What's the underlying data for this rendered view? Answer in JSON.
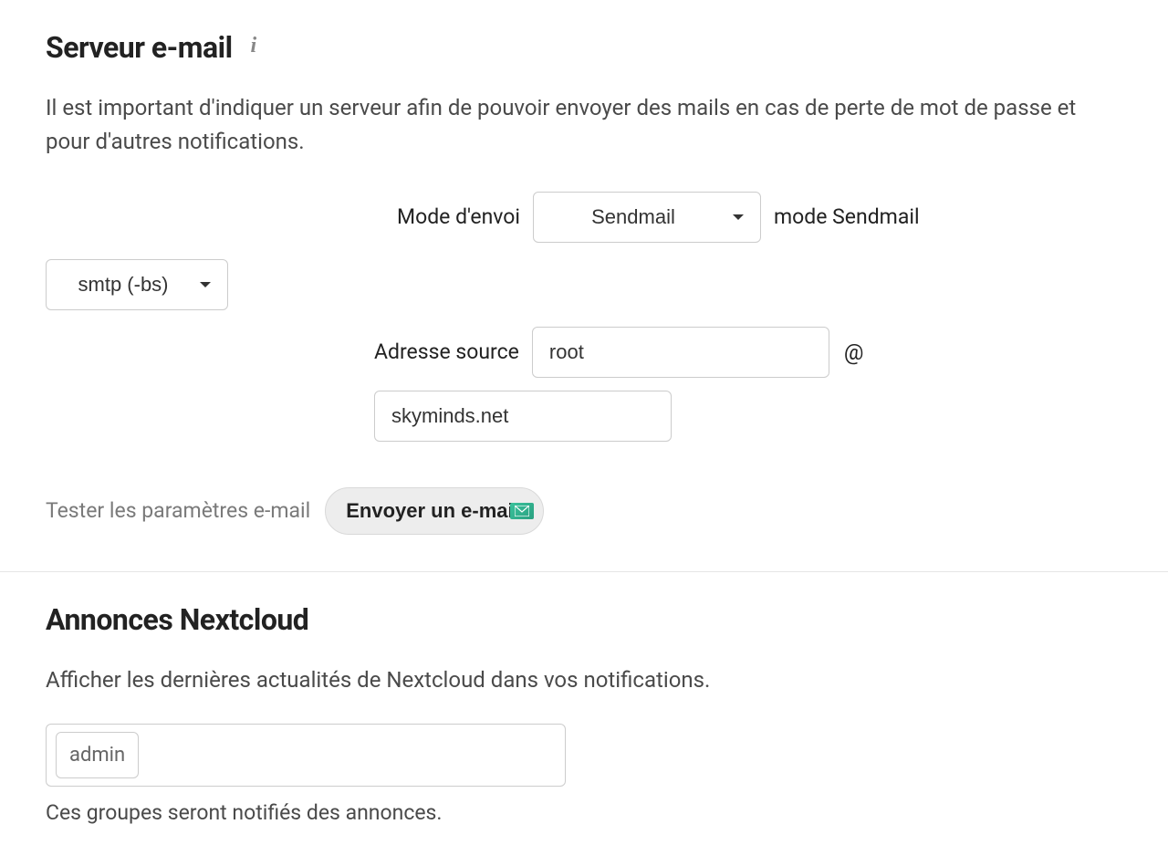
{
  "emailServer": {
    "title": "Serveur e-mail",
    "description": "Il est important d'indiquer un serveur afin de pouvoir envoyer des mails en cas de perte de mot de passe et pour d'autres notifications.",
    "sendModeLabel": "Mode d'envoi",
    "sendModeValue": "Sendmail",
    "sendModeSuffix": "mode Sendmail",
    "sendmailModeValue": "smtp (-bs)",
    "sourceLabel": "Adresse source",
    "sourceUser": "root",
    "atSymbol": "@",
    "sourceDomain": "skyminds.net",
    "testLabel": "Tester les paramètres e-mail",
    "sendButton": "Envoyer un e-mail"
  },
  "announcements": {
    "title": "Annonces Nextcloud",
    "description": "Afficher les dernières actualités de Nextcloud dans vos notifications.",
    "groups": [
      "admin"
    ],
    "helperText": "Ces groupes seront notifiés des annonces."
  }
}
